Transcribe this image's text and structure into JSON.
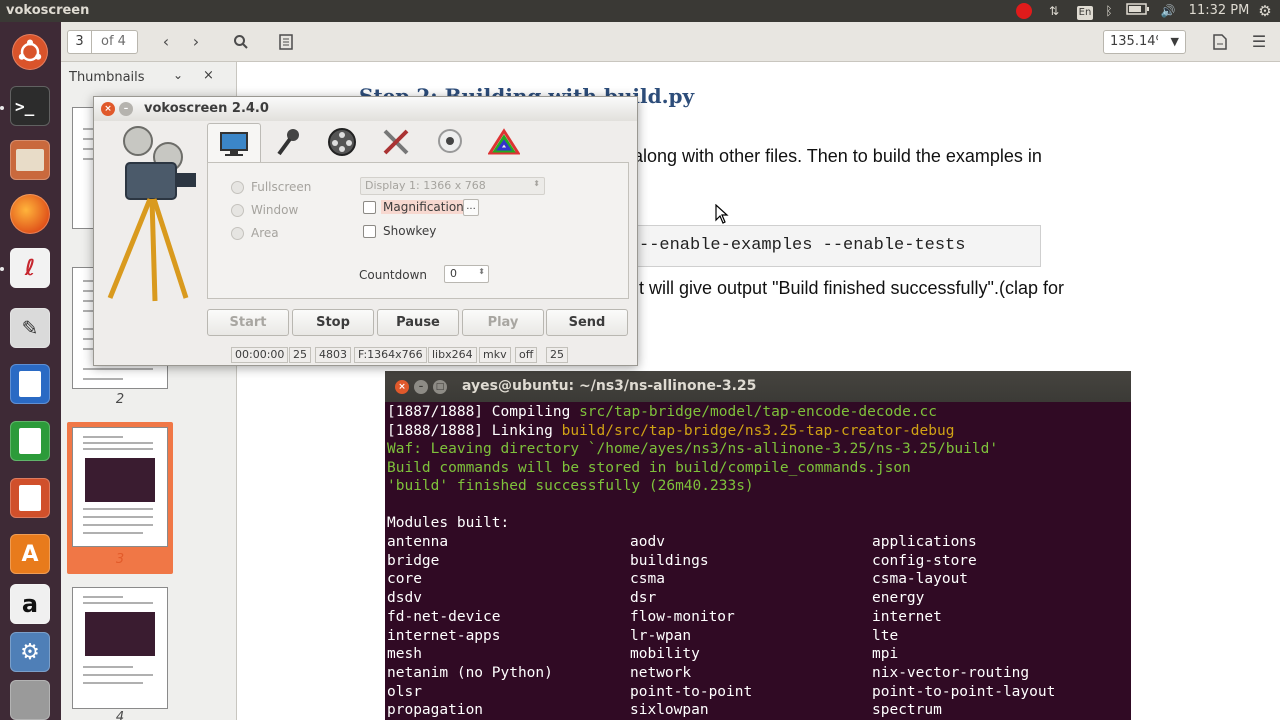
{
  "topbar": {
    "app_title": "vokoscreen",
    "keyboard_layout": "En",
    "time": "11:32 PM",
    "icons": [
      "record-icon",
      "network-icon",
      "keyboard-icon",
      "bluetooth-icon",
      "battery-icon",
      "volume-icon",
      "settings-icon"
    ]
  },
  "launcher": {
    "items": [
      "ubuntu-dash",
      "terminal",
      "files",
      "firefox",
      "document-viewer",
      "text-editor",
      "libreoffice-writer",
      "libreoffice-calc",
      "libreoffice-impress",
      "software-center",
      "amazon",
      "system-settings",
      "workspaces"
    ]
  },
  "viewer": {
    "page_current": "3",
    "page_total": "of 4",
    "zoom": "135.14%",
    "sidebar_title": "Thumbnails",
    "thumbnail_numbers": [
      "2",
      "3",
      "4"
    ],
    "page": {
      "heading": "Step 2: Building with build.py",
      "line1": "along with other files.  Then to build the examples in",
      "code": "--enable-examples --enable-tests",
      "line2": "it will give output \"Build finished successfully\".(clap for"
    }
  },
  "terminal": {
    "title": "ayes@ubuntu: ~/ns3/ns-allinone-3.25",
    "lines": [
      {
        "prefix": "[1887/1888] Compiling ",
        "path": "src/tap-bridge/model/tap-encode-decode.cc"
      },
      {
        "prefix": "[1888/1888] Linking ",
        "path": "build/src/tap-bridge/ns3.25-tap-creator-debug"
      }
    ],
    "waf_leaving": "Waf: Leaving directory `/home/ayes/ns3/ns-allinone-3.25/ns-3.25/build'",
    "build_commands": "Build commands will be stored in build/compile_commands.json",
    "finished": "'build' finished successfully (26m40.233s)",
    "modules_header": "Modules built:",
    "modules": [
      [
        "antenna",
        "aodv",
        "applications"
      ],
      [
        "bridge",
        "buildings",
        "config-store"
      ],
      [
        "core",
        "csma",
        "csma-layout"
      ],
      [
        "dsdv",
        "dsr",
        "energy"
      ],
      [
        "fd-net-device",
        "flow-monitor",
        "internet"
      ],
      [
        "internet-apps",
        "lr-wpan",
        "lte"
      ],
      [
        "mesh",
        "mobility",
        "mpi"
      ],
      [
        "netanim (no Python)",
        "network",
        "nix-vector-routing"
      ],
      [
        "olsr",
        "point-to-point",
        "point-to-point-layout"
      ],
      [
        "propagation",
        "sixlowpan",
        "spectrum"
      ]
    ]
  },
  "vokoscreen": {
    "title": "vokoscreen 2.4.0",
    "tabs": [
      "screen-tab",
      "audio-tab",
      "video-tab",
      "settings-tab",
      "webcam-tab",
      "about-tab"
    ],
    "fullscreen": "Fullscreen",
    "window": "Window",
    "area": "Area",
    "display": "Display 1:  1366 x 768",
    "magnification": "Magnification",
    "magnification_more": "...",
    "showkey": "Showkey",
    "countdown_label": "Countdown",
    "countdown_value": "0",
    "buttons": {
      "start": "Start",
      "stop": "Stop",
      "pause": "Pause",
      "play": "Play",
      "send": "Send"
    },
    "status": [
      "00:00:00",
      "25",
      "4803",
      "F:1364x766",
      "libx264",
      "mkv",
      "off",
      "25"
    ]
  },
  "colors": {
    "launcher_bg": "#3e2a36",
    "terminal_bg": "#300a24",
    "selection_orange": "#f07746",
    "terminal_green": "#7ec13b",
    "terminal_orange": "#d0a215"
  }
}
